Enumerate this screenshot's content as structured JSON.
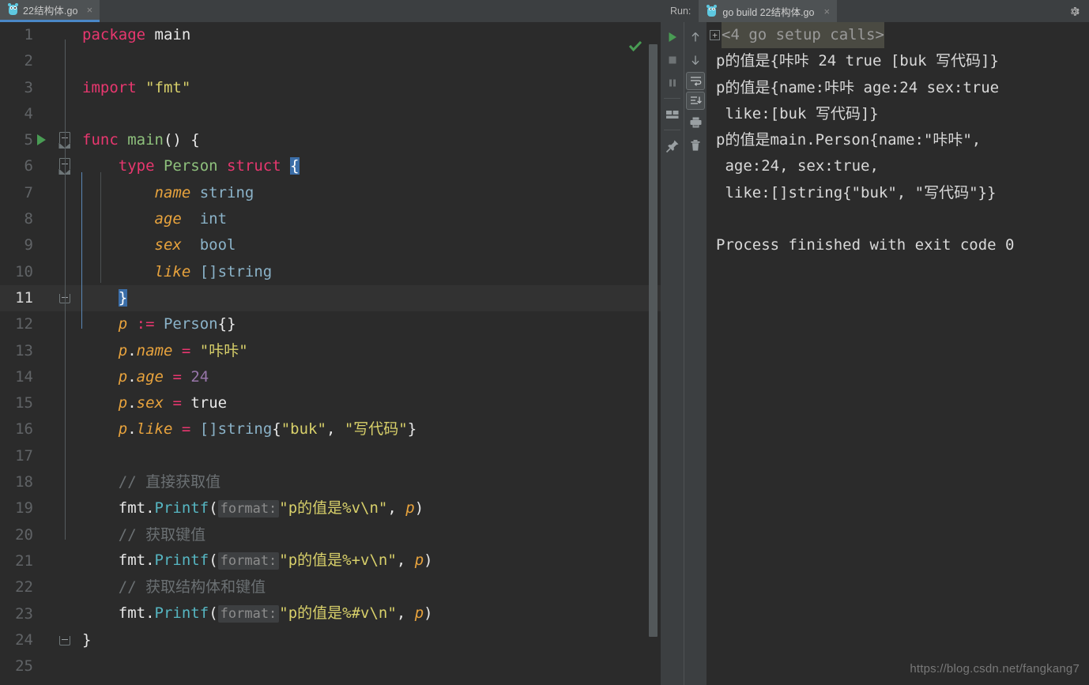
{
  "editor": {
    "tab": {
      "icon": "go-gopher-icon",
      "label": "22结构体.go",
      "close": "×"
    },
    "lines": [
      {
        "n": "1",
        "segments": [
          {
            "t": "package ",
            "c": "kw-pink"
          },
          {
            "t": "main",
            "c": "white"
          }
        ]
      },
      {
        "n": "2",
        "segments": []
      },
      {
        "n": "3",
        "segments": [
          {
            "t": "import ",
            "c": "kw-pink"
          },
          {
            "t": "\"fmt\"",
            "c": "str"
          }
        ]
      },
      {
        "n": "4",
        "segments": []
      },
      {
        "n": "5",
        "segments": [
          {
            "t": "func ",
            "c": "kw-pink"
          },
          {
            "t": "main",
            "c": "green"
          },
          {
            "t": "() ",
            "c": "white"
          },
          {
            "t": "{",
            "c": "white"
          }
        ]
      },
      {
        "n": "6",
        "segments": [
          {
            "t": "    ",
            "c": "ident"
          },
          {
            "t": "type ",
            "c": "kw-pink"
          },
          {
            "t": "Person ",
            "c": "green"
          },
          {
            "t": "struct ",
            "c": "kw-pink"
          },
          {
            "t": "{",
            "c": "brace-hl"
          }
        ]
      },
      {
        "n": "7",
        "segments": [
          {
            "t": "        ",
            "c": "ident"
          },
          {
            "t": "name",
            "c": "field"
          },
          {
            "t": " string",
            "c": "type"
          }
        ]
      },
      {
        "n": "8",
        "segments": [
          {
            "t": "        ",
            "c": "ident"
          },
          {
            "t": "age",
            "c": "field"
          },
          {
            "t": "  int",
            "c": "type"
          }
        ]
      },
      {
        "n": "9",
        "segments": [
          {
            "t": "        ",
            "c": "ident"
          },
          {
            "t": "sex",
            "c": "field"
          },
          {
            "t": "  bool",
            "c": "type"
          }
        ]
      },
      {
        "n": "10",
        "segments": [
          {
            "t": "        ",
            "c": "ident"
          },
          {
            "t": "like",
            "c": "field"
          },
          {
            "t": " []string",
            "c": "type"
          }
        ]
      },
      {
        "n": "11",
        "segments": [
          {
            "t": "    ",
            "c": "ident"
          },
          {
            "t": "}",
            "c": "brace-hl"
          }
        ]
      },
      {
        "n": "12",
        "segments": [
          {
            "t": "    ",
            "c": "ident"
          },
          {
            "t": "p",
            "c": "field"
          },
          {
            "t": " := ",
            "c": "op"
          },
          {
            "t": "Person",
            "c": "type"
          },
          {
            "t": "{}",
            "c": "white"
          }
        ]
      },
      {
        "n": "13",
        "segments": [
          {
            "t": "    ",
            "c": "ident"
          },
          {
            "t": "p",
            "c": "field"
          },
          {
            "t": ".",
            "c": "white"
          },
          {
            "t": "name",
            "c": "field"
          },
          {
            "t": " = ",
            "c": "op"
          },
          {
            "t": "\"咔咔\"",
            "c": "str"
          }
        ]
      },
      {
        "n": "14",
        "segments": [
          {
            "t": "    ",
            "c": "ident"
          },
          {
            "t": "p",
            "c": "field"
          },
          {
            "t": ".",
            "c": "white"
          },
          {
            "t": "age",
            "c": "field"
          },
          {
            "t": " = ",
            "c": "op"
          },
          {
            "t": "24",
            "c": "num"
          }
        ]
      },
      {
        "n": "15",
        "segments": [
          {
            "t": "    ",
            "c": "ident"
          },
          {
            "t": "p",
            "c": "field"
          },
          {
            "t": ".",
            "c": "white"
          },
          {
            "t": "sex",
            "c": "field"
          },
          {
            "t": " = ",
            "c": "op"
          },
          {
            "t": "true",
            "c": "white"
          }
        ]
      },
      {
        "n": "16",
        "segments": [
          {
            "t": "    ",
            "c": "ident"
          },
          {
            "t": "p",
            "c": "field"
          },
          {
            "t": ".",
            "c": "white"
          },
          {
            "t": "like",
            "c": "field"
          },
          {
            "t": " = ",
            "c": "op"
          },
          {
            "t": "[]string",
            "c": "type"
          },
          {
            "t": "{",
            "c": "white"
          },
          {
            "t": "\"buk\"",
            "c": "str"
          },
          {
            "t": ", ",
            "c": "white"
          },
          {
            "t": "\"写代码\"",
            "c": "str"
          },
          {
            "t": "}",
            "c": "white"
          }
        ]
      },
      {
        "n": "17",
        "segments": []
      },
      {
        "n": "18",
        "segments": [
          {
            "t": "    ",
            "c": "ident"
          },
          {
            "t": "// 直接获取值",
            "c": "comment"
          }
        ]
      },
      {
        "n": "19",
        "segments": [
          {
            "t": "    ",
            "c": "ident"
          },
          {
            "t": "fmt",
            "c": "white"
          },
          {
            "t": ".",
            "c": "white"
          },
          {
            "t": "Printf",
            "c": "fn"
          },
          {
            "t": "(",
            "c": "white"
          },
          {
            "t": "format:",
            "c": "hint"
          },
          {
            "t": "\"p的值是%v\\n\"",
            "c": "str"
          },
          {
            "t": ", ",
            "c": "white"
          },
          {
            "t": "p",
            "c": "field"
          },
          {
            "t": ")",
            "c": "white"
          }
        ]
      },
      {
        "n": "20",
        "segments": [
          {
            "t": "    ",
            "c": "ident"
          },
          {
            "t": "// 获取键值",
            "c": "comment"
          }
        ]
      },
      {
        "n": "21",
        "segments": [
          {
            "t": "    ",
            "c": "ident"
          },
          {
            "t": "fmt",
            "c": "white"
          },
          {
            "t": ".",
            "c": "white"
          },
          {
            "t": "Printf",
            "c": "fn"
          },
          {
            "t": "(",
            "c": "white"
          },
          {
            "t": "format:",
            "c": "hint"
          },
          {
            "t": "\"p的值是%+v\\n\"",
            "c": "str"
          },
          {
            "t": ", ",
            "c": "white"
          },
          {
            "t": "p",
            "c": "field"
          },
          {
            "t": ")",
            "c": "white"
          }
        ]
      },
      {
        "n": "22",
        "segments": [
          {
            "t": "    ",
            "c": "ident"
          },
          {
            "t": "// 获取结构体和键值",
            "c": "comment"
          }
        ]
      },
      {
        "n": "23",
        "segments": [
          {
            "t": "    ",
            "c": "ident"
          },
          {
            "t": "fmt",
            "c": "white"
          },
          {
            "t": ".",
            "c": "white"
          },
          {
            "t": "Printf",
            "c": "fn"
          },
          {
            "t": "(",
            "c": "white"
          },
          {
            "t": "format:",
            "c": "hint"
          },
          {
            "t": "\"p的值是%#v\\n\"",
            "c": "str"
          },
          {
            "t": ", ",
            "c": "white"
          },
          {
            "t": "p",
            "c": "field"
          },
          {
            "t": ")",
            "c": "white"
          }
        ]
      },
      {
        "n": "24",
        "segments": [
          {
            "t": "}",
            "c": "white"
          }
        ]
      },
      {
        "n": "25",
        "segments": []
      }
    ],
    "current_line": "11",
    "run_arrow_line": "5",
    "inspection_status": "ok-checkmark"
  },
  "run_panel": {
    "label": "Run:",
    "tab": {
      "icon": "go-gopher-icon",
      "label": "go build 22结构体.go",
      "close": "×"
    },
    "settings_icon": "gear-icon",
    "toolbar_primary": [
      {
        "name": "rerun-button",
        "icon": "play-icon"
      },
      {
        "name": "stop-button",
        "icon": "stop-icon"
      },
      {
        "name": "pause-button",
        "icon": "pause-icon"
      },
      {
        "name": "layout-button",
        "icon": "layout-icon"
      },
      {
        "name": "pin-tab-button",
        "icon": "pin-icon"
      }
    ],
    "toolbar_secondary": [
      {
        "name": "previous-occurrence-button",
        "icon": "arrow-up-icon"
      },
      {
        "name": "next-occurrence-button",
        "icon": "arrow-down-icon"
      },
      {
        "name": "soft-wrap-button",
        "icon": "soft-wrap-icon"
      },
      {
        "name": "scroll-to-end-button",
        "icon": "scroll-end-icon"
      },
      {
        "name": "print-button",
        "icon": "printer-icon"
      },
      {
        "name": "clear-all-button",
        "icon": "trash-icon"
      }
    ],
    "console": {
      "folded_label": "<4 go setup calls>",
      "fold_toggle": "+",
      "lines": [
        "p的值是{咔咔 24 true [buk 写代码]}",
        "p的值是{name:咔咔 age:24 sex:true",
        " like:[buk 写代码]}",
        "p的值是main.Person{name:\"咔咔\",",
        " age:24, sex:true,",
        " like:[]string{\"buk\", \"写代码\"}}",
        "",
        "Process finished with exit code 0"
      ]
    }
  },
  "watermark": "https://blog.csdn.net/fangkang7",
  "colors": {
    "editor_bg": "#2b2b2b",
    "panel_bg": "#3c3f41",
    "current_line_bg": "#323232",
    "tab_active_underline": "#4a88c7",
    "keyword": "#e8376f",
    "string": "#d8d06a",
    "number": "#9876aa",
    "field": "#e8a33d",
    "type": "#8bb3c9",
    "function": "#56b6c2",
    "comment": "#6b7073",
    "run_green": "#499c54",
    "brace_highlight": "#3b6ea8"
  }
}
